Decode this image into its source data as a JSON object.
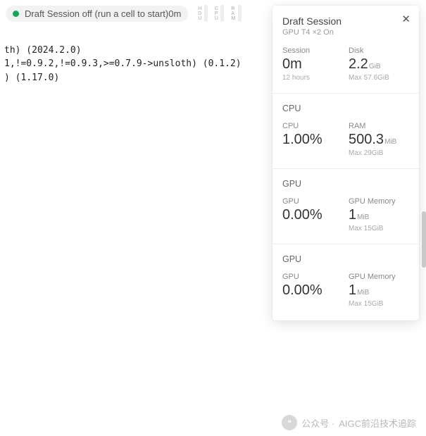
{
  "topbar": {
    "status_text": "Draft Session off (run a cell to start)0m",
    "mini": [
      {
        "l1": "H",
        "l2": "D",
        "l3": "U"
      },
      {
        "l1": "C",
        "l2": "P",
        "l3": "U"
      },
      {
        "l1": "R",
        "l2": "A",
        "l3": "M"
      }
    ]
  },
  "code": {
    "line1": "th) (2024.2.0)",
    "line2": "1,!=0.9.2,!=0.9.3,>=0.7.9->unsloth) (0.1.2)",
    "line3": ") (1.17.0)"
  },
  "panel": {
    "title": "Draft Session",
    "subtitle": "GPU T4 ×2 On",
    "close": "✕",
    "session": {
      "label": "Session",
      "value": "0m",
      "sub": "12 hours"
    },
    "disk": {
      "label": "Disk",
      "value": "2.2",
      "unit": "GiB",
      "sub": "Max 57.6GiB"
    },
    "cpu_section": {
      "title": "CPU",
      "cpu": {
        "label": "CPU",
        "value": "1.00%"
      },
      "ram": {
        "label": "RAM",
        "value": "500.3",
        "unit": "MiB",
        "sub": "Max 29GiB"
      }
    },
    "gpu1": {
      "title": "GPU",
      "util": {
        "label": "GPU",
        "value": "0.00%"
      },
      "mem": {
        "label": "GPU Memory",
        "value": "1",
        "unit": "MiB",
        "sub": "Max 15GiB"
      }
    },
    "gpu2": {
      "title": "GPU",
      "util": {
        "label": "GPU",
        "value": "0.00%"
      },
      "mem": {
        "label": "GPU Memory",
        "value": "1",
        "unit": "MiB",
        "sub": "Max 15GiB"
      }
    }
  },
  "watermark": {
    "prefix": "公众号 · ",
    "text": "AIGC前沿技术追踪",
    "badge": "❝"
  }
}
